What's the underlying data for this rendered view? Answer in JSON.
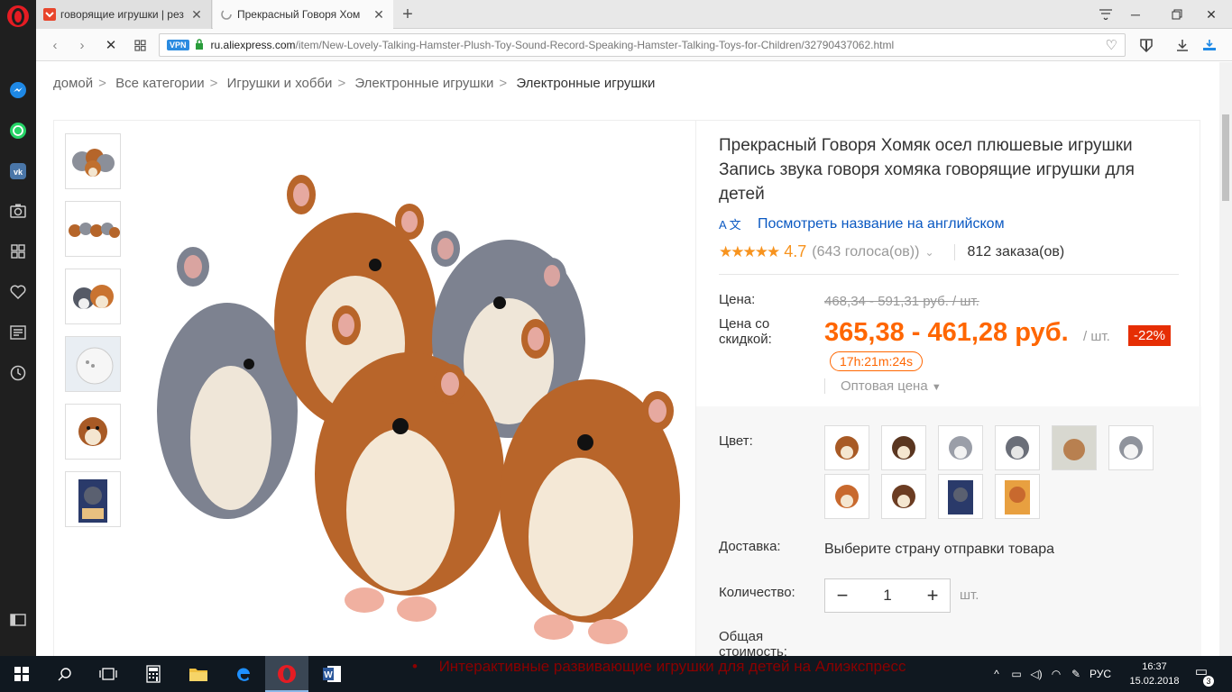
{
  "browser": {
    "tabs": [
      {
        "title": "говорящие игрушки | рез",
        "active": false
      },
      {
        "title": "Прекрасный Говоря Хом",
        "active": true
      }
    ],
    "vpn_label": "VPN",
    "url_domain": "ru.aliexpress.com",
    "url_path": "/item/New-Lovely-Talking-Hamster-Plush-Toy-Sound-Record-Speaking-Hamster-Talking-Toys-for-Children/32790437062.html"
  },
  "sidebar": {
    "icons": [
      "opera-logo",
      "messenger-icon",
      "whatsapp-icon",
      "vk-icon",
      "camera-icon",
      "speed-dial-icon",
      "heart-icon",
      "news-icon",
      "history-icon",
      "sidebar-toggle-icon"
    ]
  },
  "breadcrumb": {
    "items": [
      "домой",
      "Все категории",
      "Игрушки и хобби",
      "Электронные игрушки",
      "Электронные игрушки"
    ],
    "separator": ">"
  },
  "product": {
    "title": "Прекрасный Говоря Хомяк осел плюшевые игрушки Запись звука говоря хомяка говорящие игрушки для детей",
    "translate_link": "Посмотреть название на английском",
    "translate_icon_text": "A 文",
    "stars": "★★★★★",
    "rating": "4.7",
    "votes": "(643 голоса(ов))",
    "orders": "812 заказа(ов)",
    "price_label": "Цена:",
    "old_price": "468,34 - 591,31 руб. / шт.",
    "discount_label": "Цена со скидкой:",
    "new_price": "365,38 - 461,28 руб.",
    "per_unit": "/ шт.",
    "discount": "-22%",
    "timer": "17h:21m:24s",
    "wholesale": "Оптовая цена",
    "color_label": "Цвет:",
    "shipping_label": "Доставка:",
    "shipping_value": "Выберите страну отправки товара",
    "qty_label": "Количество:",
    "qty_value": "1",
    "qty_unit": "шт.",
    "total_label": "Общая стоимость:",
    "colors_accent": "#f60"
  },
  "overlay": {
    "bullet_text": "Интерактивные развивающие игрушки для детей на Алиэкспресс"
  },
  "taskbar": {
    "language": "РУС",
    "time": "16:37",
    "date": "15.02.2018",
    "notifications": "3"
  }
}
